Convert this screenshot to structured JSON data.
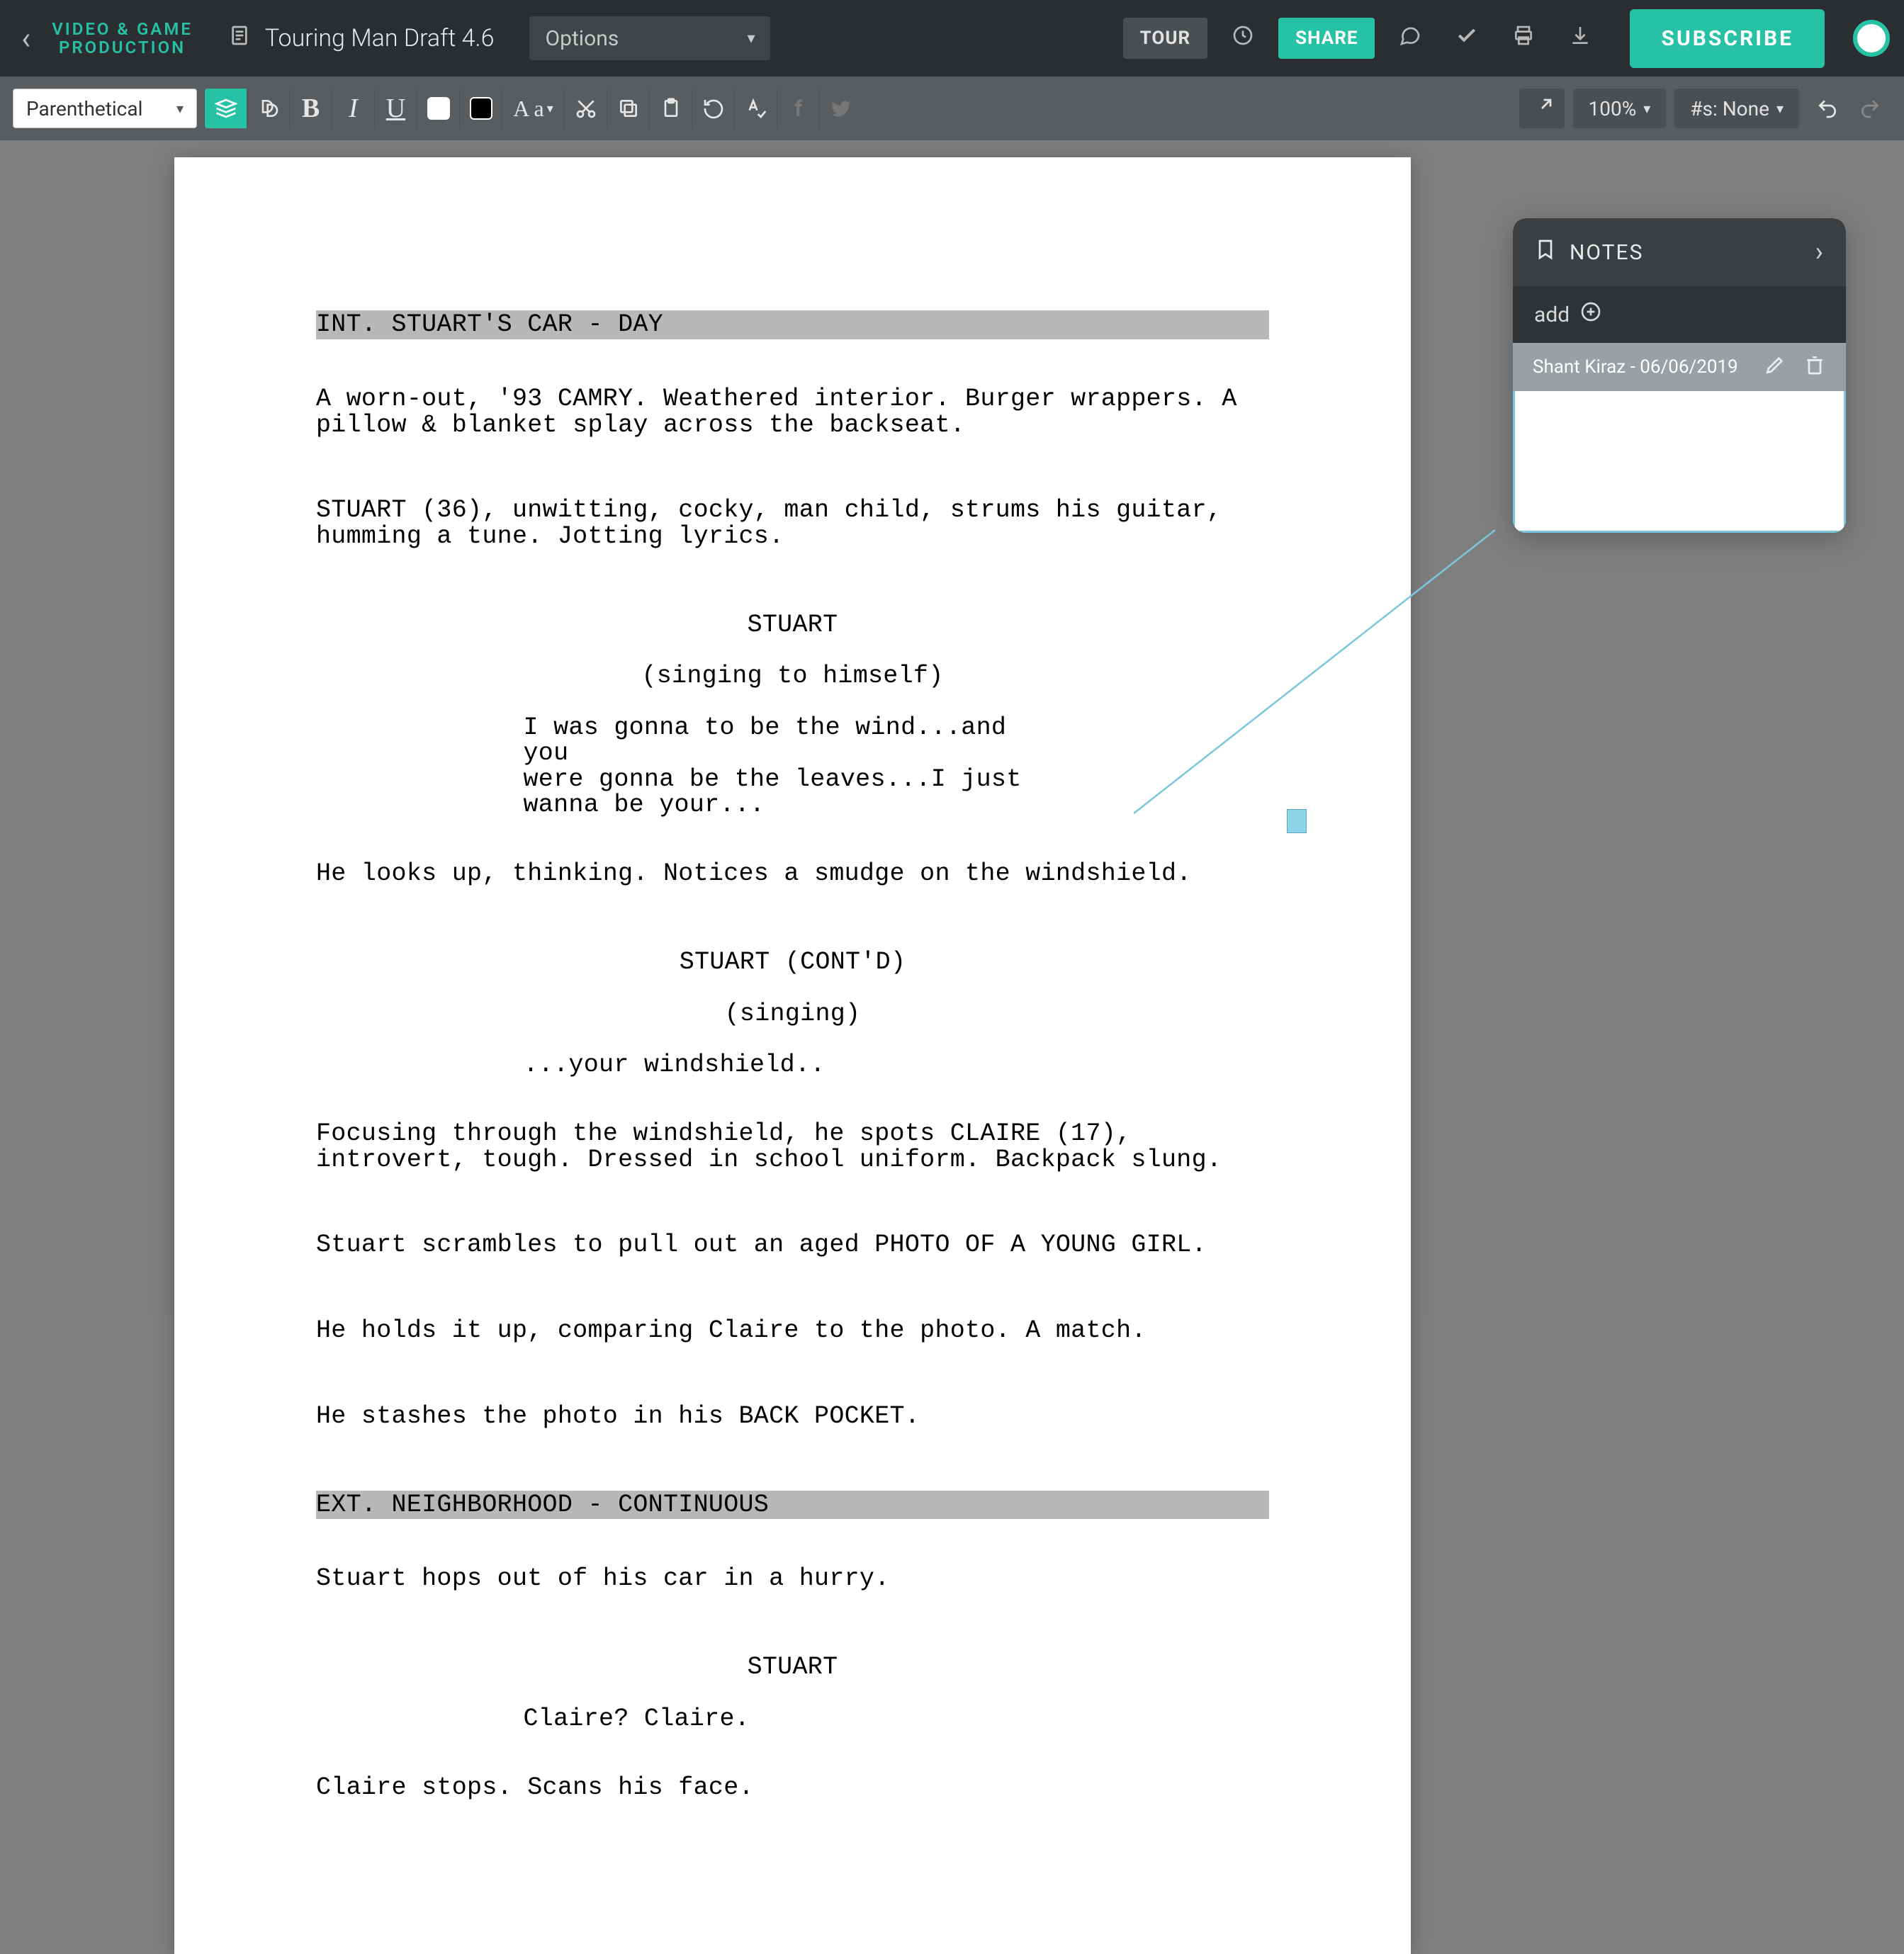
{
  "header": {
    "brand_line1": "VIDEO & GAME",
    "brand_line2": "PRODUCTION",
    "doc_title": "Touring Man Draft 4.6",
    "options_label": "Options",
    "tour_label": "TOUR",
    "share_label": "SHARE",
    "subscribe_label": "SUBSCRIBE"
  },
  "fmt": {
    "element_type": "Parenthetical",
    "case_label": "A a",
    "zoom": "100%",
    "numbering": "#s: None"
  },
  "notes": {
    "title": "NOTES",
    "add_label": "add",
    "author": "Shant Kiraz",
    "date": "06/06/2019"
  },
  "script": {
    "scene1_slug": "INT. STUART'S CAR - DAY",
    "action1": "A worn-out, '93 CAMRY. Weathered interior. Burger wrappers. A pillow & blanket splay across the backseat.",
    "action2": "STUART (36), unwitting, cocky, man child, strums his guitar, humming a tune. Jotting lyrics.",
    "cue1": "STUART",
    "paren1": "(singing to himself)",
    "dialog1": "I was gonna to be the wind...and you\nwere gonna be the leaves...I just\nwanna be your...",
    "action3": "He looks up, thinking. Notices a smudge on the windshield.",
    "cue2": "STUART (CONT'D)",
    "paren2": "(singing)",
    "dialog2": "...your windshield..",
    "action4": "Focusing through the windshield, he spots CLAIRE (17), introvert, tough. Dressed in school uniform. Backpack slung.",
    "action5": "Stuart scrambles to pull out an aged PHOTO OF A YOUNG GIRL.",
    "action6": "He holds it up, comparing Claire to the photo. A match.",
    "action7": "He stashes the photo in his BACK POCKET.",
    "scene2_slug": "EXT. NEIGHBORHOOD - CONTINUOUS",
    "action8": "Stuart hops out of his car in a hurry.",
    "cue3": "STUART",
    "dialog3": "Claire? Claire.",
    "action9": "Claire stops. Scans his face."
  }
}
